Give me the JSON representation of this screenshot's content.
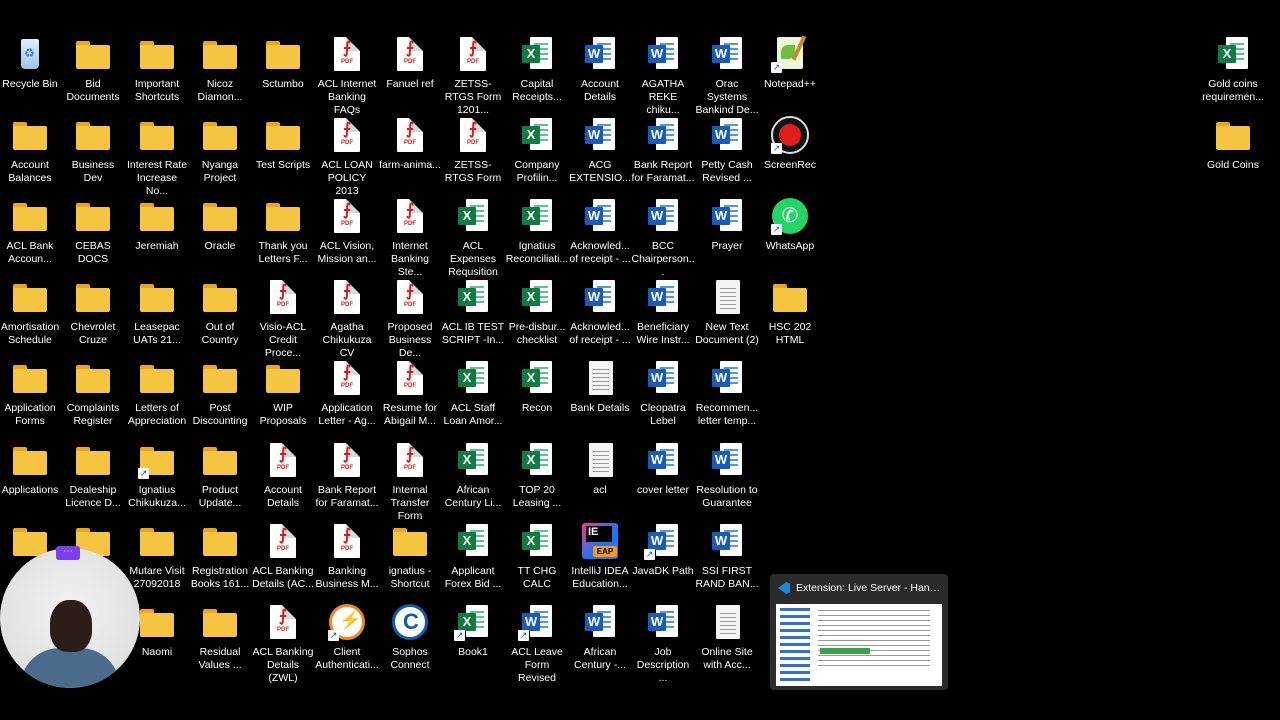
{
  "icons": [
    {
      "label": "Recycle Bin",
      "icon": "recycle-bin-icon"
    },
    {
      "label": "Bid Documents",
      "icon": "folder-icon"
    },
    {
      "label": "Important Shortcuts",
      "icon": "folder-icon"
    },
    {
      "label": "Nicoz Diamon...",
      "icon": "folder-icon"
    },
    {
      "label": "Sctumbo",
      "icon": "folder-icon"
    },
    {
      "label": "ACL Internet Banking FAQs",
      "icon": "pdf-icon"
    },
    {
      "label": "Fanuel ref",
      "icon": "pdf-icon"
    },
    {
      "label": "ZETSS-RTGS Form 1201...",
      "icon": "pdf-icon"
    },
    {
      "label": "Capital Receipts...",
      "icon": "excel-icon"
    },
    {
      "label": "Account Details",
      "icon": "word-icon"
    },
    {
      "label": "AGATHA REKE chiku...",
      "icon": "word-icon"
    },
    {
      "label": "Orac Systems Bankind De...",
      "icon": "word-icon"
    },
    {
      "label": "Notepad++",
      "icon": "notepad-plus-plus-icon"
    },
    {
      "label": "Gold coins requiremen...",
      "icon": "excel-icon"
    },
    {
      "label": "Account Balances",
      "icon": "folder-icon"
    },
    {
      "label": "Business Dev",
      "icon": "folder-icon"
    },
    {
      "label": "Interest Rate Increase No...",
      "icon": "folder-icon"
    },
    {
      "label": "Nyanga Project",
      "icon": "folder-icon"
    },
    {
      "label": "Test Scripts",
      "icon": "folder-icon"
    },
    {
      "label": "ACL LOAN POLICY 2013",
      "icon": "pdf-icon"
    },
    {
      "label": "farm-anima...",
      "icon": "pdf-icon"
    },
    {
      "label": "ZETSS-RTGS Form",
      "icon": "pdf-icon"
    },
    {
      "label": "Company Profilin...",
      "icon": "excel-icon"
    },
    {
      "label": "ACG EXTENSIO...",
      "icon": "word-icon"
    },
    {
      "label": "Bank Report for Faramat...",
      "icon": "word-icon"
    },
    {
      "label": "Petty Cash Revised ...",
      "icon": "word-icon"
    },
    {
      "label": "ScreenRec",
      "icon": "screenrec-icon"
    },
    {
      "label": "Gold Coins",
      "icon": "folder-icon"
    },
    {
      "label": "ACL Bank Accoun...",
      "icon": "folder-icon"
    },
    {
      "label": "CEBAS DOCS",
      "icon": "folder-icon"
    },
    {
      "label": "Jeremiah",
      "icon": "folder-icon"
    },
    {
      "label": "Oracle",
      "icon": "folder-icon"
    },
    {
      "label": "Thank you Letters F...",
      "icon": "folder-icon"
    },
    {
      "label": "ACL Vision, Mission an...",
      "icon": "pdf-icon"
    },
    {
      "label": "Internet Banking Ste...",
      "icon": "pdf-icon"
    },
    {
      "label": "ACL Expenses Requsition F...",
      "icon": "excel-icon"
    },
    {
      "label": "Ignatius Reconciliati...",
      "icon": "excel-icon"
    },
    {
      "label": "Acknowled... of receipt - ...",
      "icon": "word-icon"
    },
    {
      "label": "BCC Chairperson...",
      "icon": "word-icon"
    },
    {
      "label": "Prayer",
      "icon": "word-icon"
    },
    {
      "label": "WhatsApp",
      "icon": "whatsapp-icon"
    },
    {
      "label": "Amortisation Schedule",
      "icon": "folder-icon"
    },
    {
      "label": "Chevrolet Cruze",
      "icon": "folder-icon"
    },
    {
      "label": "Leasepac UATs 21...",
      "icon": "folder-icon"
    },
    {
      "label": "Out of Country",
      "icon": "folder-icon"
    },
    {
      "label": "Visio-ACL Credit Proce...",
      "icon": "pdf-icon"
    },
    {
      "label": "Agatha Chikukuza CV",
      "icon": "pdf-icon"
    },
    {
      "label": "Proposed Business De...",
      "icon": "pdf-icon"
    },
    {
      "label": "ACL IB TEST SCRIPT -In...",
      "icon": "excel-icon"
    },
    {
      "label": "Pre-disbur... checklist",
      "icon": "excel-icon"
    },
    {
      "label": "Acknowled... of receipt - ...",
      "icon": "word-icon"
    },
    {
      "label": "Beneficiary Wire Instr...",
      "icon": "word-icon"
    },
    {
      "label": "New Text Document (2)",
      "icon": "text-file-icon"
    },
    {
      "label": "HSC 202 HTML",
      "icon": "folder-icon"
    },
    {
      "label": "Application Forms",
      "icon": "folder-icon"
    },
    {
      "label": "Complaints Register",
      "icon": "folder-icon"
    },
    {
      "label": "Letters of Appreciation",
      "icon": "folder-icon"
    },
    {
      "label": "Post Discounting",
      "icon": "folder-icon"
    },
    {
      "label": "WIP Proposals",
      "icon": "folder-icon"
    },
    {
      "label": "Application Letter - Ag...",
      "icon": "pdf-icon"
    },
    {
      "label": "Resume for Abigail M...",
      "icon": "pdf-icon"
    },
    {
      "label": "ACL Staff Loan Amor...",
      "icon": "excel-icon"
    },
    {
      "label": "Recon",
      "icon": "excel-icon"
    },
    {
      "label": "Bank Details",
      "icon": "text-file-icon"
    },
    {
      "label": "Cleopatra Lebel",
      "icon": "word-icon"
    },
    {
      "label": "Recommen... letter temp...",
      "icon": "word-icon"
    },
    {
      "label": "Applications",
      "icon": "folder-icon"
    },
    {
      "label": "Dealeship Licence D...",
      "icon": "folder-icon"
    },
    {
      "label": "Ignatius Chikukuza...",
      "icon": "folder-icon"
    },
    {
      "label": "Product Update...",
      "icon": "folder-icon"
    },
    {
      "label": "Account Details",
      "icon": "pdf-icon"
    },
    {
      "label": "Bank Report for Faramat...",
      "icon": "pdf-icon"
    },
    {
      "label": "Internal Transfer Form",
      "icon": "pdf-icon"
    },
    {
      "label": "African Century Li...",
      "icon": "excel-icon"
    },
    {
      "label": "TOP 20 Leasing ...",
      "icon": "excel-icon"
    },
    {
      "label": "acl",
      "icon": "text-file-icon"
    },
    {
      "label": "cover letter",
      "icon": "word-icon"
    },
    {
      "label": "Resolution to Guarantee",
      "icon": "word-icon"
    },
    {
      "label": "",
      "icon": "folder-icon"
    },
    {
      "label": "",
      "icon": "folder-icon"
    },
    {
      "label": "Mutare Visit 27092018",
      "icon": "folder-icon"
    },
    {
      "label": "Registration Books 161...",
      "icon": "folder-icon"
    },
    {
      "label": "ACL Banking Details (AC...",
      "icon": "pdf-icon"
    },
    {
      "label": "Banking Business M...",
      "icon": "pdf-icon"
    },
    {
      "label": "ignatius - Shortcut",
      "icon": "folder-icon"
    },
    {
      "label": "Applicant Forex Bid ...",
      "icon": "excel-icon"
    },
    {
      "label": "TT CHG CALC",
      "icon": "excel-icon"
    },
    {
      "label": "IntelliJ IDEA Education...",
      "icon": "intellij-idea-icon"
    },
    {
      "label": "JavaDK Path",
      "icon": "word-icon"
    },
    {
      "label": "SSI FIRST RAND BAN...",
      "icon": "word-icon"
    },
    {
      "label": "Naomi",
      "icon": "folder-icon"
    },
    {
      "label": "Residual Values ...",
      "icon": "folder-icon"
    },
    {
      "label": "ACL Banking Details (ZWL)",
      "icon": "pdf-icon"
    },
    {
      "label": "Client Authenticati...",
      "icon": "client-auth-icon"
    },
    {
      "label": "Sophos Connect",
      "icon": "sophos-connect-icon"
    },
    {
      "label": "Book1",
      "icon": "excel-icon"
    },
    {
      "label": "ACL Leave Form Revised",
      "icon": "word-icon"
    },
    {
      "label": "African Century -...",
      "icon": "word-icon"
    },
    {
      "label": "Job Description ...",
      "icon": "word-icon"
    },
    {
      "label": "Online Site with Acc...",
      "icon": "text-file-icon"
    }
  ],
  "taskbar_preview": {
    "title": "Extension: Live Server - Handov...",
    "icon": "vscode-icon"
  },
  "webcam": {
    "menu_label": "⋯"
  }
}
